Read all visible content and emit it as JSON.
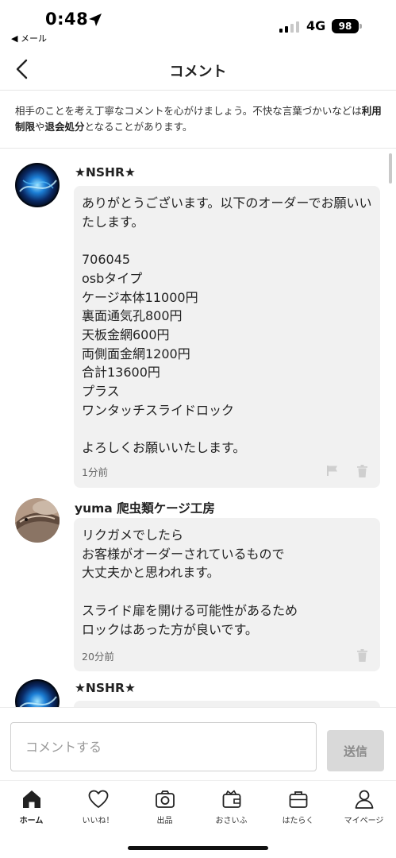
{
  "status_bar": {
    "time": "0:48",
    "back_app": "◀ メール",
    "network": "4G",
    "battery": "98"
  },
  "header": {
    "title": "コメント"
  },
  "notice": {
    "text_before": "相手のことを考え丁寧なコメントを心がけましょう。不快な言葉づかいなどは",
    "bold1": "利用制限",
    "text_mid": "や",
    "bold2": "退会処分",
    "text_after": "となることがあります。"
  },
  "comments": [
    {
      "name": "★NSHR★",
      "text": "ありがとうございます。以下のオーダーでお願いいたします。\n\n706045\nosbタイプ\nケージ本体11000円\n裏面通気孔800円\n天板金網600円\n両側面金網1200円\n合計13600円\nプラス\nワンタッチスライドロック\n\nよろしくお願いいたします。",
      "time": "1分前",
      "avatar_icon": "blue-swirl-avatar-icon"
    },
    {
      "name": "yuma 爬虫類ケージ工房",
      "text": "リクガメでしたら\nお客様がオーダーされているもので\n大丈夫かと思われます。\n\nスライド扉を開ける可能性があるため\nロックはあった方が良いです。",
      "time": "20分前",
      "avatar_icon": "reptile-avatar-icon"
    },
    {
      "name": "★NSHR★",
      "text": "",
      "time": "",
      "avatar_icon": "blue-swirl-avatar-icon"
    }
  ],
  "input": {
    "placeholder": "コメントする",
    "send_label": "送信"
  },
  "tabbar": {
    "items": [
      {
        "label": "ホーム",
        "icon": "home-icon"
      },
      {
        "label": "いいね！",
        "icon": "heart-icon"
      },
      {
        "label": "出品",
        "icon": "camera-icon"
      },
      {
        "label": "おさいふ",
        "icon": "wallet-icon"
      },
      {
        "label": "はたらく",
        "icon": "briefcase-icon"
      },
      {
        "label": "マイページ",
        "icon": "person-icon"
      }
    ]
  },
  "colors": {
    "bubble_bg": "#f1f1f1",
    "send_disabled_bg": "#d9d9d9",
    "text_primary": "#222222"
  }
}
